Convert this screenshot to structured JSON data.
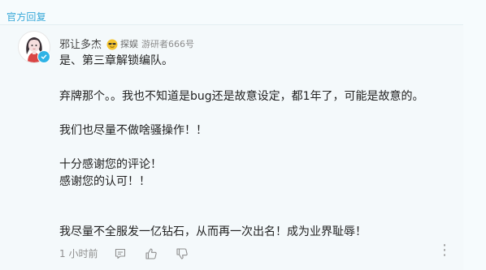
{
  "section_label": "官方回复",
  "author": {
    "name": "邪让多杰",
    "title_tag": "探娱",
    "user_meta": "游研者666号"
  },
  "body_lines": [
    "是、第三章解锁编队。",
    "弃牌那个。。我也不知道是bug还是故意设定，都1年了，可能是故意的。",
    "我们也尽量不做啥骚操作！！",
    "十分感谢您的评论！",
    "感谢您的认可！！",
    "我尽量不全服发一亿钻石，从而再一次出名！成为业界耻辱！"
  ],
  "footer": {
    "time": "1 小时前"
  },
  "icons": {
    "emoji": "sunglasses-face-icon",
    "comment": "comment-icon",
    "like": "thumbs-up-icon",
    "dislike": "thumbs-down-icon",
    "more": "more-options-icon",
    "verified": "verified-badge-icon"
  },
  "colors": {
    "accent": "#35a7d8",
    "text": "#222222",
    "muted": "#8e8e8e",
    "background": "#f4f9fb"
  }
}
